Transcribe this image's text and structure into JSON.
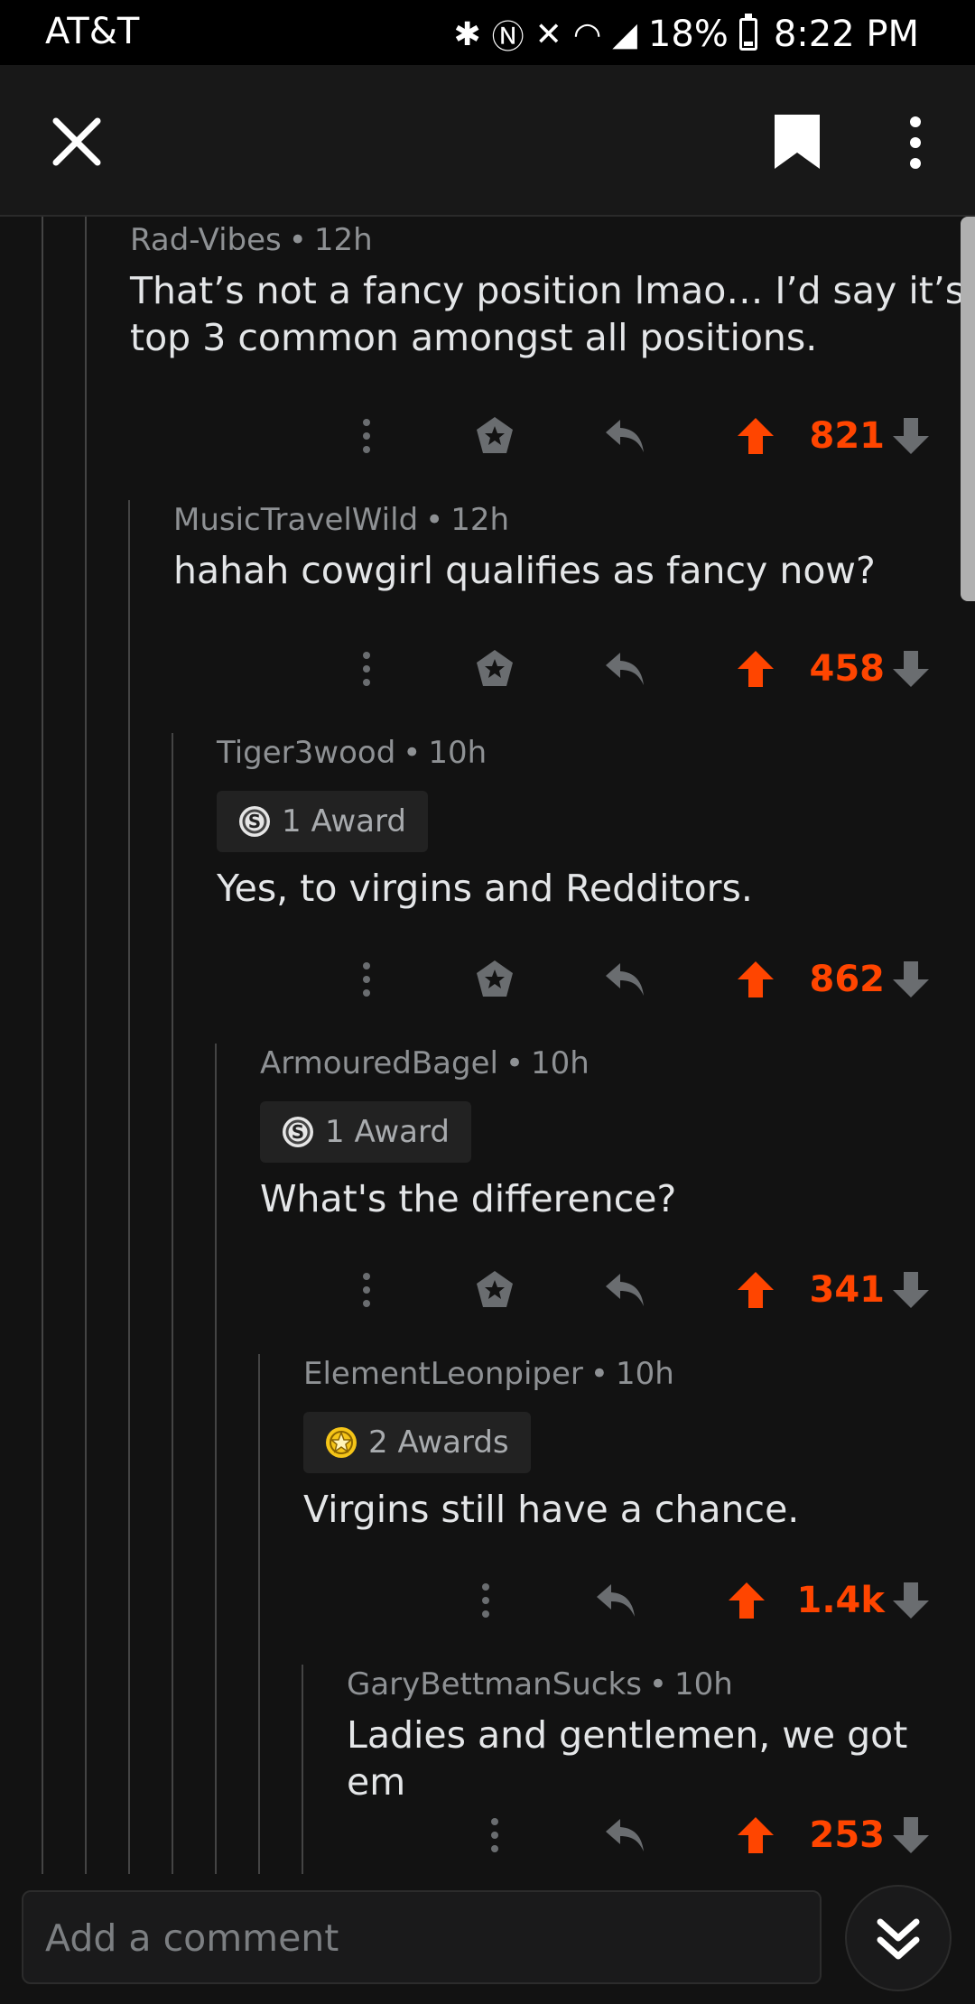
{
  "status_bar": {
    "carrier": "AT&T",
    "battery": "18%",
    "time": "8:22 PM"
  },
  "comments": [
    {
      "author": "Rad-Vibes",
      "age": "12h",
      "body_line1": "That’s not a fancy position lmao… I’d say it’s",
      "body_line2": "top 3 common amongst all positions.",
      "score": "821"
    },
    {
      "author": "MusicTravelWild",
      "age": "12h",
      "body_line1": "hahah cowgirl qualifies as fancy now?",
      "score": "458"
    },
    {
      "author": "Tiger3wood",
      "age": "10h",
      "award": "1 Award",
      "body_line1": "Yes, to virgins and Redditors.",
      "score": "862"
    },
    {
      "author": "ArmouredBagel",
      "age": "10h",
      "award": "1 Award",
      "body_line1": "What's the difference?",
      "score": "341"
    },
    {
      "author": "ElementLeonpiper",
      "age": "10h",
      "award": "2 Awards",
      "body_line1": "Virgins still have a chance.",
      "score": "1.4k"
    },
    {
      "author": "GaryBettmanSucks",
      "age": "10h",
      "body_line1": "Ladies and gentlemen, we got em",
      "score": "253"
    }
  ],
  "composer": {
    "placeholder": "Add a comment"
  },
  "icons": {
    "close": "close-icon",
    "bookmark": "bookmark-icon",
    "more": "more-vertical-icon",
    "upvote": "upvote-arrow-icon",
    "downvote": "downvote-arrow-icon",
    "reply": "reply-icon",
    "award": "award-icon",
    "jump": "double-chevron-down-icon"
  },
  "colors": {
    "accent_upvote": "#ff4500",
    "background": "#121212",
    "text": "#e4e6e8",
    "muted": "#8e9194"
  }
}
